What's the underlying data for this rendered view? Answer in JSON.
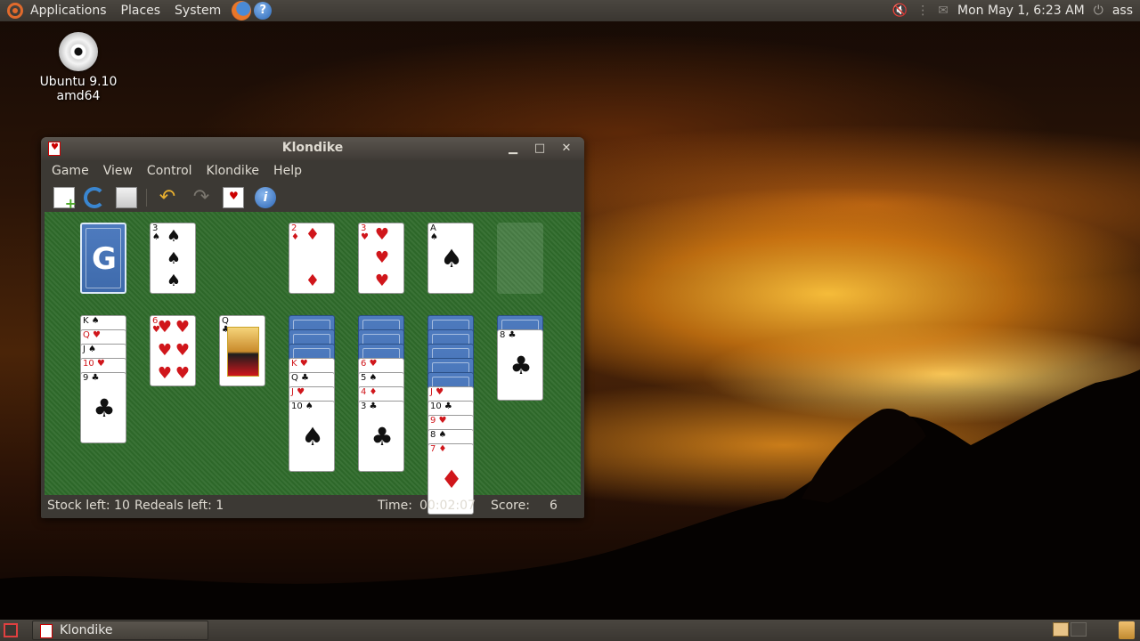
{
  "top_panel": {
    "menus": [
      "Applications",
      "Places",
      "System"
    ],
    "clock": "Mon May  1,  6:23 AM",
    "user": "ass"
  },
  "desktop": {
    "icon_label": "Ubuntu 9.10 amd64"
  },
  "window": {
    "title": "Klondike",
    "menu": [
      "Game",
      "View",
      "Control",
      "Klondike",
      "Help"
    ],
    "toolbar": [
      "new-game-icon",
      "restart-icon",
      "hint-icon",
      "undo-icon",
      "redo-icon",
      "deal-icon",
      "info-icon"
    ],
    "status": {
      "stock": "Stock left: 10",
      "redeals": "Redeals left: 1",
      "time_label": "Time:",
      "time": "00:02:07",
      "score_label": "Score:",
      "score": "6"
    }
  },
  "cards": {
    "waste": {
      "rank": "3",
      "suit": "♠"
    },
    "foundation1": {
      "rank": "2",
      "suit": "♦"
    },
    "foundation2": {
      "rank": "3",
      "suit": "♥"
    },
    "foundation3": {
      "rank": "A",
      "suit": "♠"
    },
    "t1": [
      "K",
      "Q",
      "J",
      "10",
      "9"
    ],
    "t1_suits": [
      "♠",
      "♥",
      "♠",
      "♥",
      "♣"
    ],
    "t2": {
      "rank": "6",
      "suit": "♥"
    },
    "t3": {
      "rank": "Q",
      "suit": "♣"
    },
    "t4": [
      "K",
      "Q",
      "J",
      "10"
    ],
    "t4_suits": [
      "♥",
      "♣",
      "♥",
      "♠"
    ],
    "t5": [
      "6",
      "5",
      "4",
      "3"
    ],
    "t5_suits": [
      "♥",
      "♠",
      "♦",
      "♣"
    ],
    "t6": [
      "J",
      "10",
      "9",
      "8",
      "7"
    ],
    "t6_suits": [
      "♥",
      "♣",
      "♥",
      "♠",
      "♦"
    ],
    "t7": {
      "rank": "8",
      "suit": "♣"
    }
  },
  "taskbar": {
    "task_label": "Klondike"
  },
  "colors": {
    "felt": "#2f6b2b",
    "panel": "#3c3934",
    "card_back": "#4e7bbf",
    "red_suit": "#d0161b"
  }
}
